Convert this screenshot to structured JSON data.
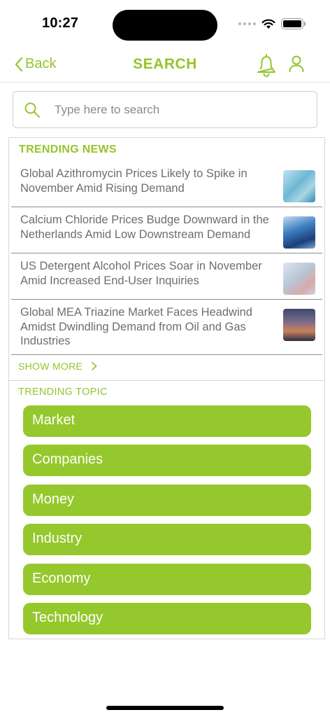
{
  "status_bar": {
    "time": "10:27"
  },
  "nav": {
    "back_label": "Back",
    "title": "SEARCH"
  },
  "search": {
    "placeholder": "Type here to search"
  },
  "trending_news": {
    "title": "TRENDING NEWS",
    "items": [
      {
        "text": "Global Azithromycin Prices Likely to Spike in November Amid Rising Demand"
      },
      {
        "text": "Calcium Chloride Prices Budge Downward in the Netherlands Amid Low Downstream Demand"
      },
      {
        "text": "US Detergent Alcohol Prices Soar in November Amid Increased End-User Inquiries"
      },
      {
        "text": "Global MEA Triazine Market Faces Headwind Amidst Dwindling Demand from Oil and Gas Industries"
      }
    ],
    "show_more": "SHOW MORE"
  },
  "trending_topic": {
    "title": "TRENDING TOPIC",
    "items": [
      "Market",
      "Companies",
      "Money",
      "Industry",
      "Economy",
      "Technology"
    ]
  },
  "colors": {
    "accent": "#95c52a",
    "topic_button": "#95c82c"
  }
}
